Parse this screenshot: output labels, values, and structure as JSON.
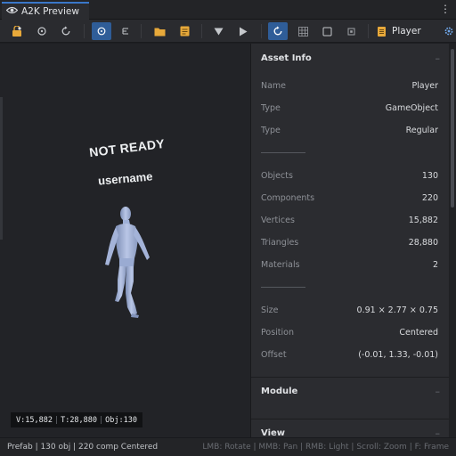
{
  "window": {
    "tab_title": "A2K Preview",
    "menu_icon": "more-vert-icon"
  },
  "toolbar": {
    "player_label": "Player",
    "buttons": [
      "lock-icon",
      "orbit-icon",
      "reset-icon",
      "pivot-icon",
      "frame-icon",
      "folder-icon",
      "file-icon",
      "dropdown-icon",
      "play-icon",
      "rotate-icon",
      "grid-icon",
      "box-icon",
      "wire-icon"
    ],
    "accent": "#2f5d98"
  },
  "viewport": {
    "status_text": "NOT READY",
    "username": "username",
    "stats": {
      "vertices": "V:15,882",
      "triangles": "T:28,880",
      "objects": "Obj:130"
    }
  },
  "panel": {
    "asset_info": {
      "title": "Asset Info",
      "rows": [
        {
          "k": "Name",
          "v": "Player"
        },
        {
          "k": "Type",
          "v": "GameObject"
        },
        {
          "k": "Type",
          "v": "Regular"
        }
      ],
      "counts": [
        {
          "k": "Objects",
          "v": "130"
        },
        {
          "k": "Components",
          "v": "220"
        },
        {
          "k": "Vertices",
          "v": "15,882"
        },
        {
          "k": "Triangles",
          "v": "28,880"
        },
        {
          "k": "Materials",
          "v": "2"
        }
      ],
      "transform": [
        {
          "k": "Size",
          "v": "0.91 × 2.77 × 0.75"
        },
        {
          "k": "Position",
          "v": "Centered"
        },
        {
          "k": "Offset",
          "v": "(-0.01, 1.33, -0.01)"
        }
      ]
    },
    "module": {
      "title": "Module"
    },
    "view": {
      "title": "View"
    },
    "chevron": "–"
  },
  "statusbar": {
    "left": "Prefab | 130 obj | 220 comp   Centered",
    "right": "LMB: Rotate | MMB: Pan | RMB: Light | Scroll: Zoom | F: Frame"
  }
}
